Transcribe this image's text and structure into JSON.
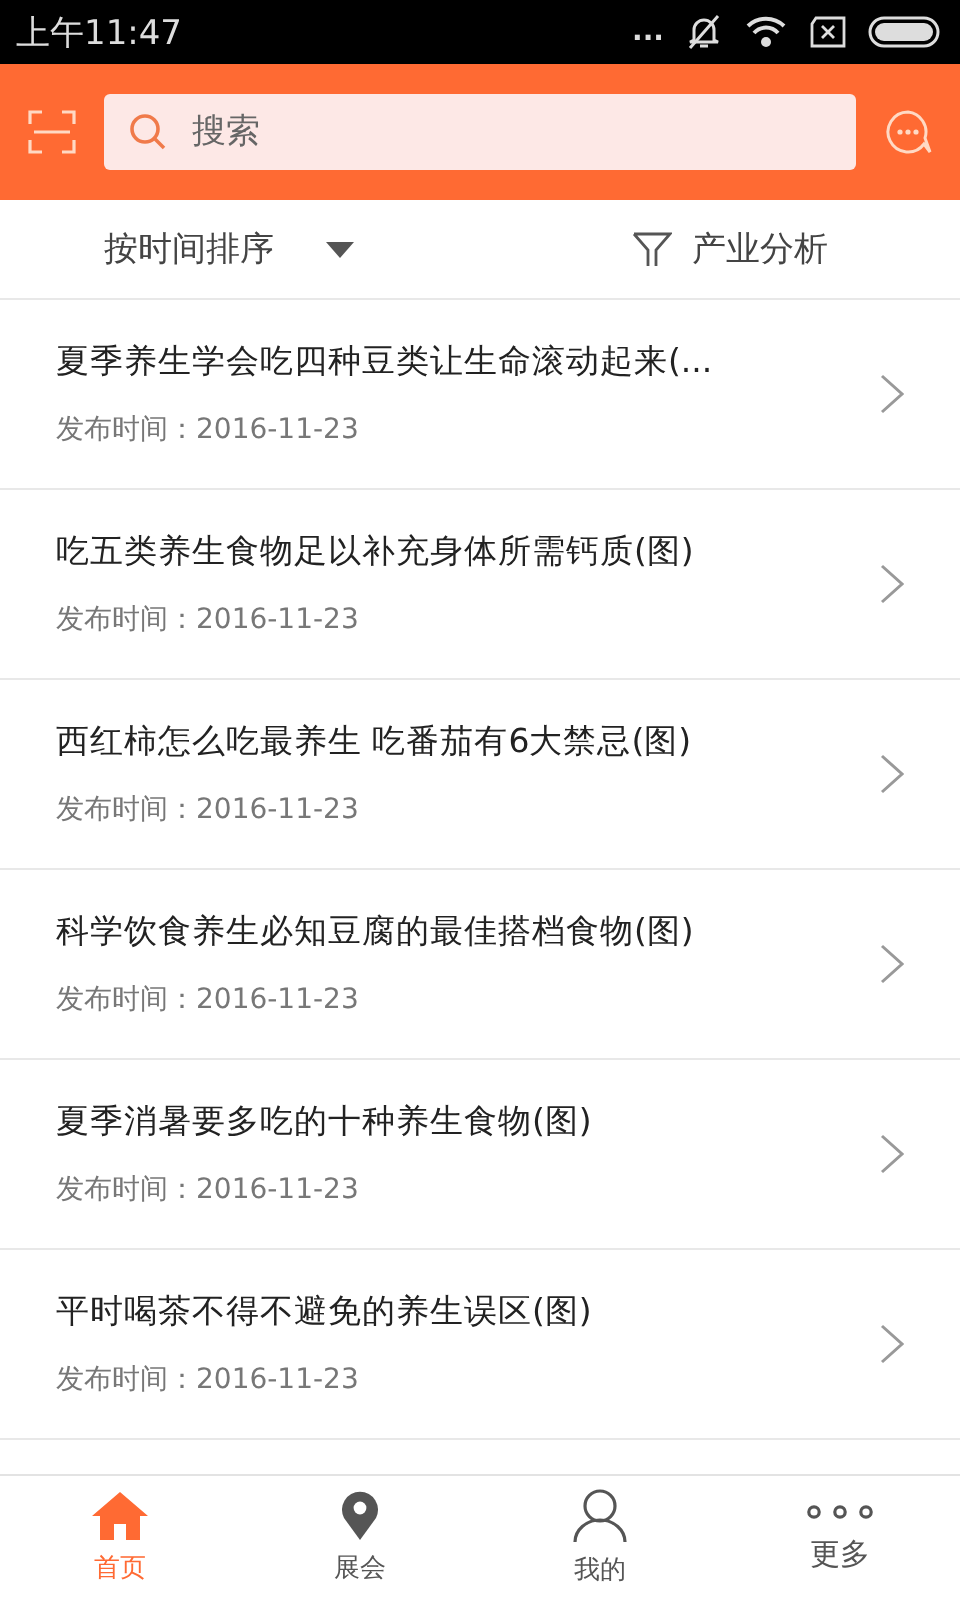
{
  "status_bar": {
    "time": "上午11:47",
    "dots": "..."
  },
  "search": {
    "placeholder": "搜索"
  },
  "filter_bar": {
    "sort": "按时间排序",
    "analysis": "产业分析"
  },
  "articles": [
    {
      "title": "夏季养生学会吃四种豆类让生命滚动起来(...",
      "date": "发布时间：2016-11-23"
    },
    {
      "title": "吃五类养生食物足以补充身体所需钙质(图)",
      "date": "发布时间：2016-11-23"
    },
    {
      "title": "西红柿怎么吃最养生 吃番茄有6大禁忌(图)",
      "date": "发布时间：2016-11-23"
    },
    {
      "title": "科学饮食养生必知豆腐的最佳搭档食物(图)",
      "date": "发布时间：2016-11-23"
    },
    {
      "title": "夏季消暑要多吃的十种养生食物(图)",
      "date": "发布时间：2016-11-23"
    },
    {
      "title": "平时喝茶不得不避免的养生误区(图)",
      "date": "发布时间：2016-11-23"
    }
  ],
  "tabs": [
    {
      "kind": "home",
      "label": "首页",
      "selected": true
    },
    {
      "kind": "pin",
      "label": "展会",
      "selected": false
    },
    {
      "kind": "person",
      "label": "我的",
      "selected": false
    },
    {
      "kind": "more",
      "label": "更多",
      "selected": false
    }
  ]
}
